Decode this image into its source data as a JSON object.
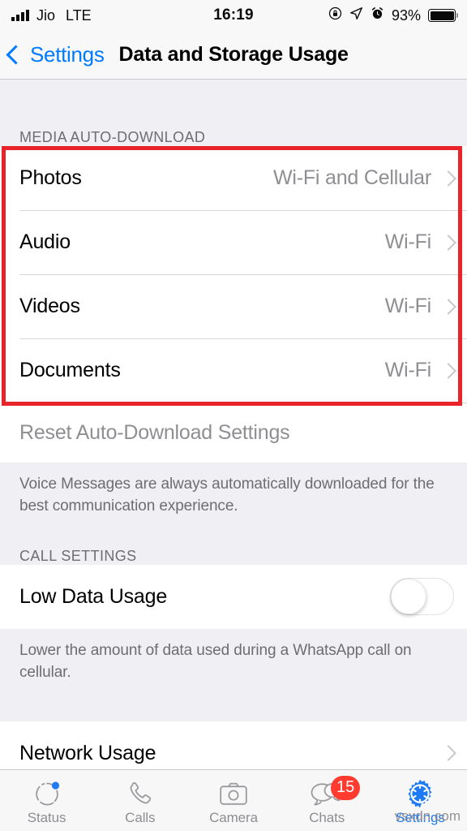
{
  "status_bar": {
    "carrier": "Jio",
    "network": "LTE",
    "time": "16:19",
    "battery_percent": "93%",
    "icons": [
      "signal-bars-icon",
      "rotation-lock-icon",
      "location-arrow-icon",
      "alarm-clock-icon",
      "battery-icon"
    ]
  },
  "nav": {
    "back_label": "Settings",
    "title": "Data and Storage Usage"
  },
  "media_section": {
    "header": "MEDIA AUTO-DOWNLOAD",
    "rows": [
      {
        "label": "Photos",
        "value": "Wi-Fi and Cellular"
      },
      {
        "label": "Audio",
        "value": "Wi-Fi"
      },
      {
        "label": "Videos",
        "value": "Wi-Fi"
      },
      {
        "label": "Documents",
        "value": "Wi-Fi"
      }
    ],
    "reset_label": "Reset Auto-Download Settings",
    "footnote": "Voice Messages are always automatically downloaded for the best communication experience.",
    "highlight_color": "#e8232a"
  },
  "call_section": {
    "header": "CALL SETTINGS",
    "low_data": {
      "label": "Low Data Usage",
      "toggle_on": false
    },
    "footnote": "Lower the amount of data used during a WhatsApp call on cellular."
  },
  "network_section": {
    "row_label": "Network Usage"
  },
  "tab_bar": {
    "tabs": [
      {
        "label": "Status",
        "icon": "status-ring-icon",
        "active": false,
        "badge": ""
      },
      {
        "label": "Calls",
        "icon": "phone-icon",
        "active": false,
        "badge": ""
      },
      {
        "label": "Camera",
        "icon": "camera-icon",
        "active": false,
        "badge": ""
      },
      {
        "label": "Chats",
        "icon": "chat-bubbles-icon",
        "active": false,
        "badge": "15"
      },
      {
        "label": "Settings",
        "icon": "gear-icon",
        "active": true,
        "badge": ""
      }
    ],
    "active_color": "#1f7bf4",
    "badge_color": "#ff3b30"
  },
  "watermark": "vsxdn.com"
}
